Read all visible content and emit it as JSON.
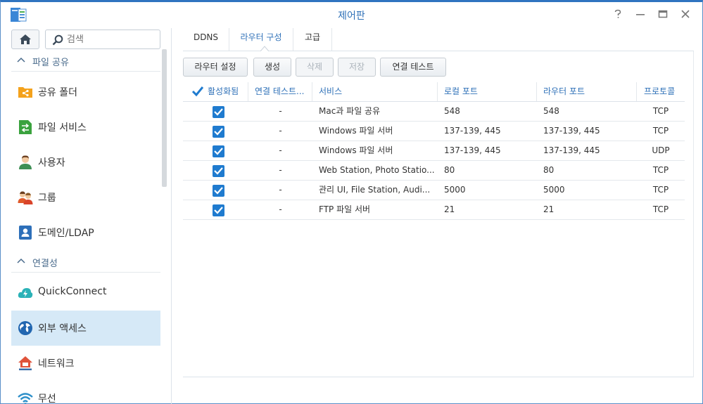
{
  "window": {
    "title": "제어판",
    "controls": [
      "help-icon",
      "minimize-icon",
      "maximize-icon",
      "close-icon"
    ],
    "accent": "#2f74c0"
  },
  "sidebar": {
    "search_placeholder": "검색",
    "sections": [
      {
        "label": "파일 공유"
      },
      {
        "label": "연결성"
      }
    ],
    "items": [
      {
        "label": "공유 폴더",
        "icon": "shared-folder-icon"
      },
      {
        "label": "파일 서비스",
        "icon": "file-services-icon"
      },
      {
        "label": "사용자",
        "icon": "user-icon"
      },
      {
        "label": "그룹",
        "icon": "group-icon"
      },
      {
        "label": "도메인/LDAP",
        "icon": "domain-ldap-icon"
      },
      {
        "label": "QuickConnect",
        "icon": "quickconnect-icon"
      },
      {
        "label": "외부 액세스",
        "icon": "external-access-icon",
        "active": true
      },
      {
        "label": "네트워크",
        "icon": "network-icon"
      },
      {
        "label": "무선",
        "icon": "wireless-icon"
      }
    ]
  },
  "tabs": [
    {
      "label": "DDNS"
    },
    {
      "label": "라우터 구성",
      "active": true
    },
    {
      "label": "고급"
    }
  ],
  "toolbar": {
    "router_setup": "라우터 설정",
    "create": "생성",
    "delete": "삭제",
    "save": "저장",
    "test_connection": "연결 테스트"
  },
  "table": {
    "columns": [
      "활성화됨",
      "연결 테스트...",
      "서비스",
      "로컬 포트",
      "라우터 포트",
      "프로토콜"
    ],
    "rows": [
      {
        "enabled": true,
        "test": "-",
        "service": "Mac과 파일 공유",
        "local_port": "548",
        "router_port": "548",
        "protocol": "TCP"
      },
      {
        "enabled": true,
        "test": "-",
        "service": "Windows 파일 서버",
        "local_port": "137-139, 445",
        "router_port": "137-139, 445",
        "protocol": "TCP"
      },
      {
        "enabled": true,
        "test": "-",
        "service": "Windows 파일 서버",
        "local_port": "137-139, 445",
        "router_port": "137-139, 445",
        "protocol": "UDP"
      },
      {
        "enabled": true,
        "test": "-",
        "service": "Web Station, Photo Statio...",
        "local_port": "80",
        "router_port": "80",
        "protocol": "TCP"
      },
      {
        "enabled": true,
        "test": "-",
        "service": "관리 UI, File Station, Audi...",
        "local_port": "5000",
        "router_port": "5000",
        "protocol": "TCP"
      },
      {
        "enabled": true,
        "test": "-",
        "service": "FTP 파일 서버",
        "local_port": "21",
        "router_port": "21",
        "protocol": "TCP"
      }
    ]
  }
}
